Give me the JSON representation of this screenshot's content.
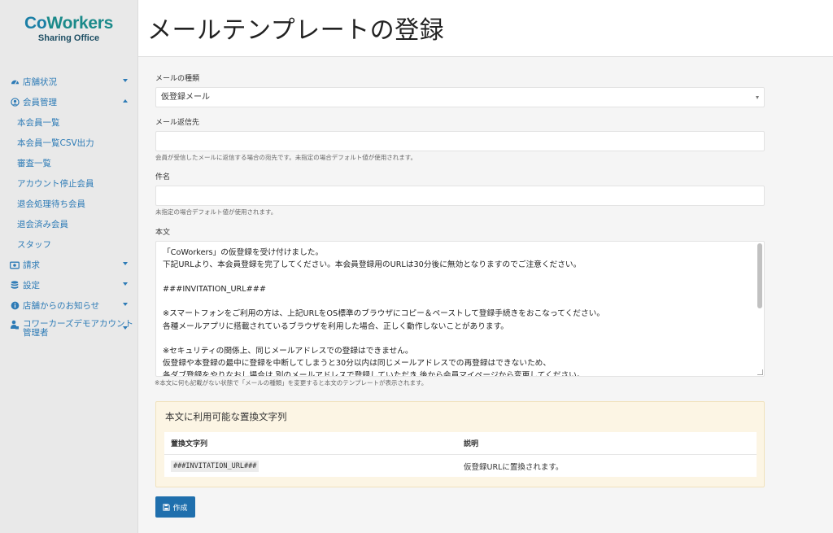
{
  "brand": {
    "logo_main_a": "Co",
    "logo_main_b": "Workers",
    "logo_sub": "Sharing Office"
  },
  "sidebar": {
    "items": [
      {
        "label": "店舗状況",
        "icon": "dashboard-icon",
        "caret": "down"
      },
      {
        "label": "会員管理",
        "icon": "user-circle-icon",
        "caret": "up"
      }
    ],
    "sub_items": [
      "本会員一覧",
      "本会員一覧CSV出力",
      "審査一覧",
      "アカウント停止会員",
      "退会処理待ち会員",
      "退会済み会員",
      "スタッフ"
    ],
    "items_after": [
      {
        "label": "請求",
        "icon": "money-icon",
        "caret": "down"
      },
      {
        "label": "設定",
        "icon": "database-icon",
        "caret": "down"
      },
      {
        "label": "店舗からのお知らせ",
        "icon": "info-circle-icon",
        "caret": "down"
      },
      {
        "label": "コワーカーズデモアカウント管理者",
        "icon": "user-lock-icon",
        "caret": "down"
      }
    ]
  },
  "header": {
    "title": "メールテンプレートの登録"
  },
  "form": {
    "mail_type_label": "メールの種類",
    "mail_type_value": "仮登録メール",
    "reply_to_label": "メール返信先",
    "reply_to_value": "",
    "reply_to_help": "会員が受信したメールに返信する場合の宛先です。未指定の場合デフォルト値が使用されます。",
    "subject_label": "件名",
    "subject_value": "",
    "subject_help": "未指定の場合デフォルト値が使用されます。",
    "body_label": "本文",
    "body_text": "「CoWorkers」の仮登録を受け付けました。\n下記URLより、本会員登録を完了してください。本会員登録用のURLは30分後に無効となりますのでご注意ください。\n\n###INVITATION_URL###\n\n※スマートフォンをご利用の方は、上記URLをOS標準のブラウザにコピー＆ペーストして登録手続きをおこなってください。\n各種メールアプリに搭載されているブラウザを利用した場合、正しく動作しないことがあります。\n\n※セキュリティの関係上、同じメールアドレスでの登録はできません。\n仮登録や本登録の最中に登録を中断してしまうと30分以内は同じメールアドレスでの再登録はできないため、\n各ダブ登録をやりなおし場合は 別のメールアドレスで登録していただき 後から会員マイページから変更してください。",
    "body_help": "※本文に何も記載がない状態で「メールの種類」を変更すると本文のテンプレートが表示されます。"
  },
  "placeholders_panel": {
    "title": "本文に利用可能な置換文字列",
    "col_string": "置換文字列",
    "col_desc": "説明",
    "rows": [
      {
        "string": "###INVITATION_URL###",
        "desc": "仮登録URLに置換されます。"
      }
    ]
  },
  "actions": {
    "create_label": "作成",
    "create_icon": "save-icon"
  },
  "colors": {
    "accent": "#2d7bb6",
    "button": "#1f6fad",
    "panel_bg": "#fcf5e4",
    "logo_teal": "#1b8a8a"
  }
}
